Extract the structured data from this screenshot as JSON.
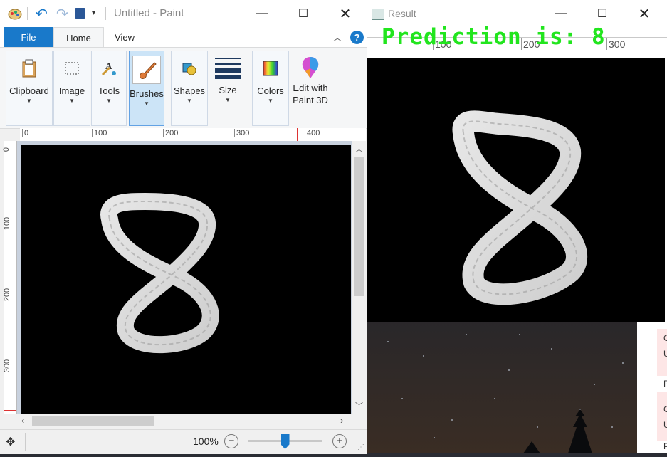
{
  "paint": {
    "title": "Untitled - Paint",
    "tabs": [
      "File",
      "Home",
      "View"
    ],
    "ribbon": {
      "clipboard": "Clipboard",
      "image": "Image",
      "tools": "Tools",
      "brushes": "Brushes",
      "shapes": "Shapes",
      "size": "Size",
      "colors": "Colors",
      "edit_3d_line1": "Edit with",
      "edit_3d_line2": "Paint 3D"
    },
    "ruler_h": [
      "0",
      "100",
      "200",
      "300",
      "400"
    ],
    "ruler_v": [
      "0",
      "100",
      "200",
      "300"
    ],
    "zoom": "100%",
    "zoom_fraction": 0.5
  },
  "result": {
    "title": "Result",
    "prediction": "Prediction is: 8",
    "ruler": [
      "100",
      "200",
      "300"
    ]
  },
  "right_strip": [
    "C",
    "U",
    "P",
    "C",
    "U",
    "P"
  ],
  "colors": {
    "accent": "#1979ca",
    "prediction": "#22e51e",
    "brush_selected": "#cce4f7"
  }
}
